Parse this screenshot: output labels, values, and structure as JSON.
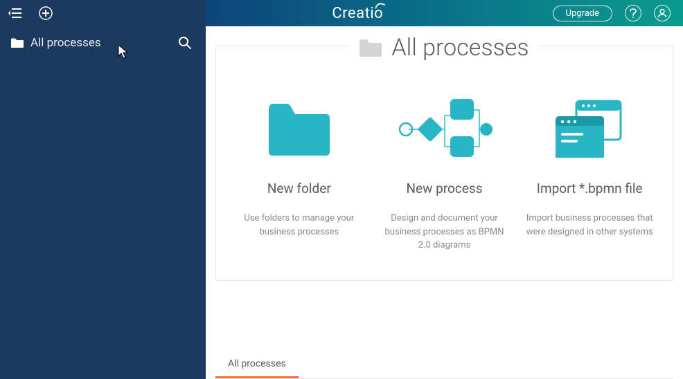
{
  "brand": "Creatio",
  "header": {
    "upgrade_label": "Upgrade"
  },
  "sidebar": {
    "all_processes_label": "All processes"
  },
  "panel": {
    "title": "All processes"
  },
  "cards": [
    {
      "title": "New folder",
      "desc": "Use folders to manage your business processes"
    },
    {
      "title": "New process",
      "desc": "Design and document your business processes as BPMN 2.0 diagrams"
    },
    {
      "title": "Import *.bpmn file",
      "desc": "Import business processes that were designed in other systems"
    }
  ],
  "tabs": {
    "all_processes": "All processes"
  }
}
